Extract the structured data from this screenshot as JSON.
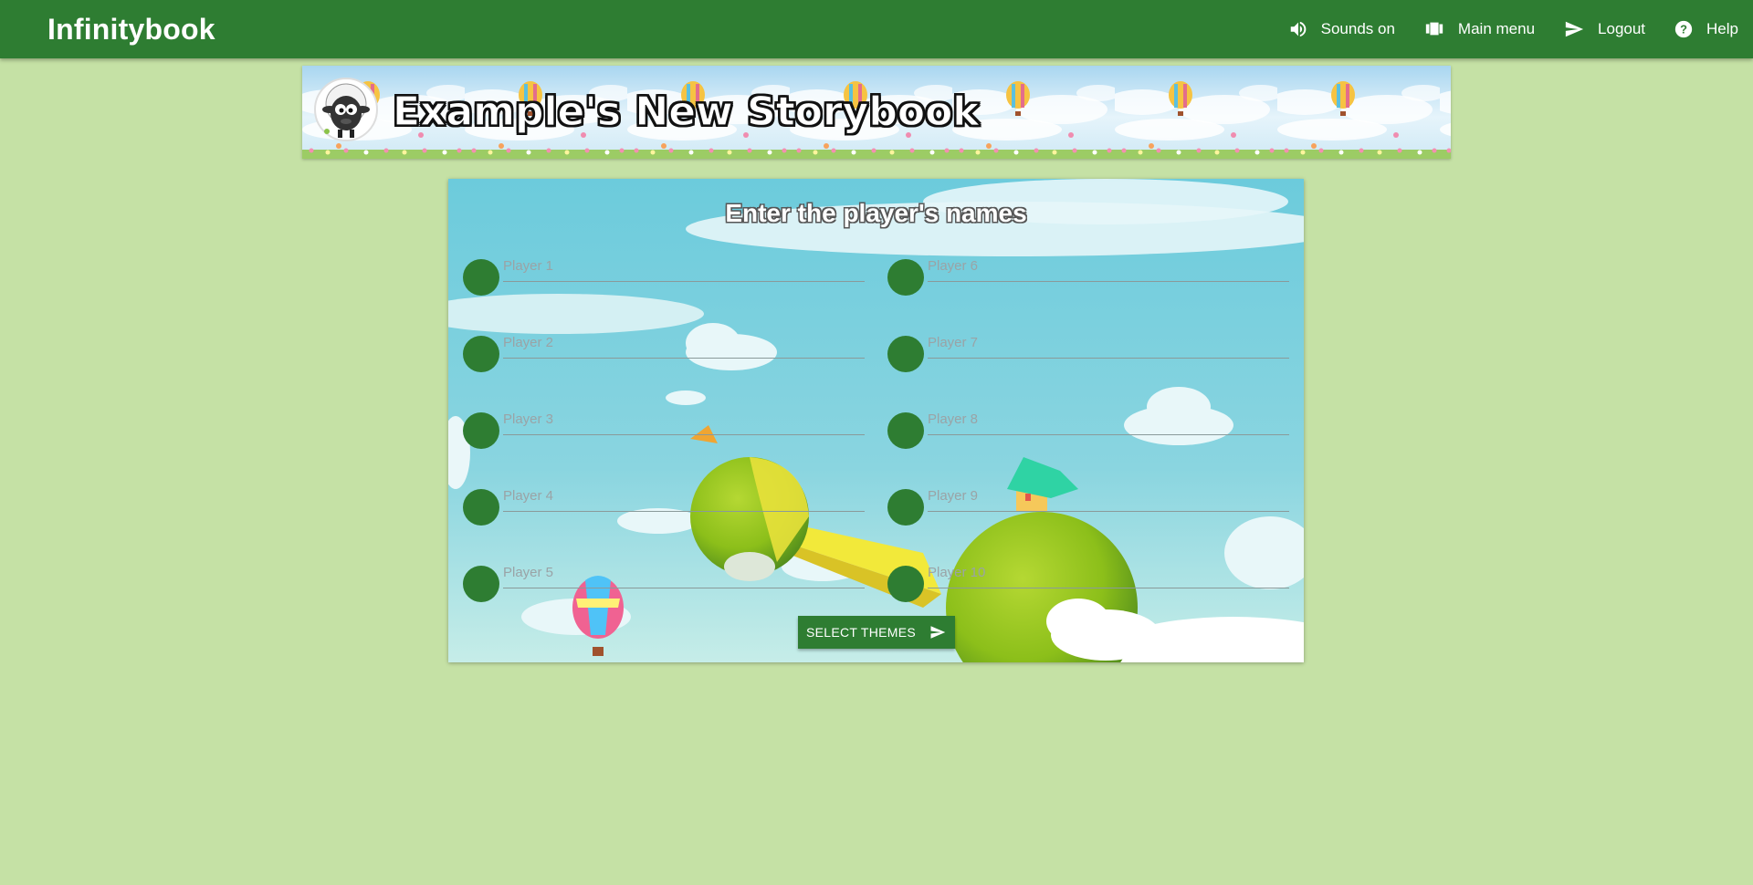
{
  "header": {
    "brand": "Infinitybook",
    "nav": [
      {
        "label": "Sounds on",
        "icon": "volume-icon"
      },
      {
        "label": "Main menu",
        "icon": "carousel-icon"
      },
      {
        "label": "Logout",
        "icon": "send-icon"
      },
      {
        "label": "Help",
        "icon": "help-icon"
      }
    ]
  },
  "banner": {
    "title": "Example's New Storybook"
  },
  "panel": {
    "title": "Enter the player's names",
    "players": [
      {
        "placeholder": "Player 1",
        "value": ""
      },
      {
        "placeholder": "Player 2",
        "value": ""
      },
      {
        "placeholder": "Player 3",
        "value": ""
      },
      {
        "placeholder": "Player 4",
        "value": ""
      },
      {
        "placeholder": "Player 5",
        "value": ""
      },
      {
        "placeholder": "Player 6",
        "value": ""
      },
      {
        "placeholder": "Player 7",
        "value": ""
      },
      {
        "placeholder": "Player 8",
        "value": ""
      },
      {
        "placeholder": "Player 9",
        "value": ""
      },
      {
        "placeholder": "Player 10",
        "value": ""
      }
    ],
    "submit_label": "SELECT THEMES"
  },
  "colors": {
    "primary": "#2e7d32",
    "page_background": "#c5e1a5",
    "sky": "#6ccbdc"
  }
}
